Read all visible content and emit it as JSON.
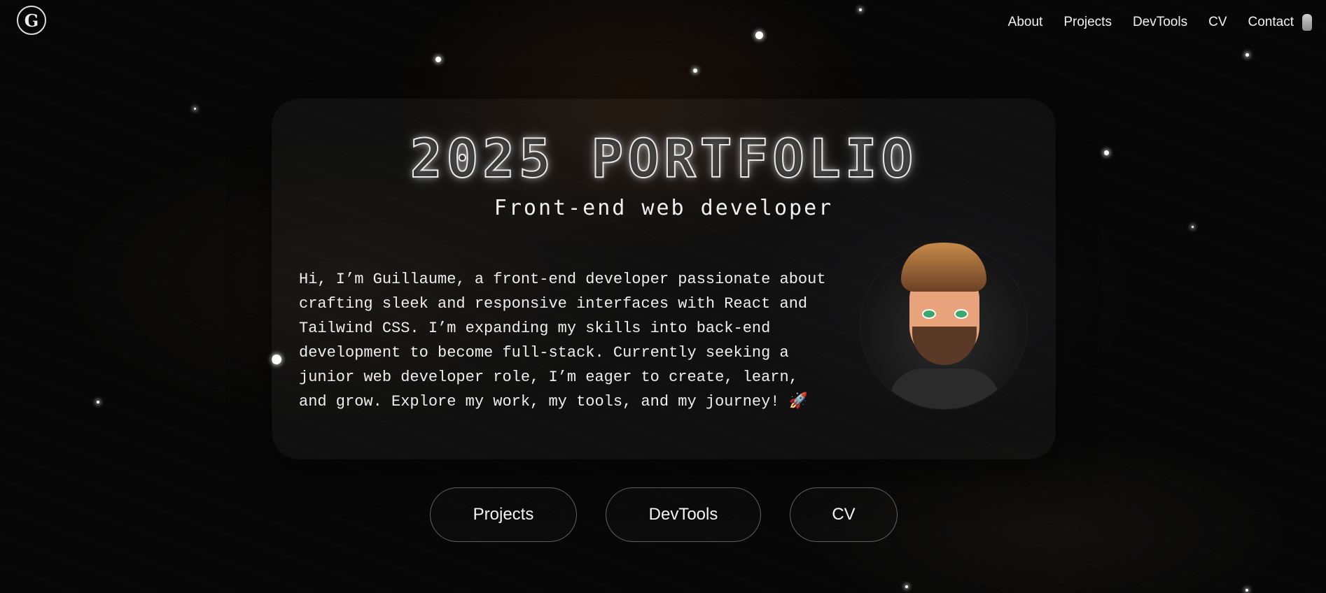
{
  "nav": {
    "logo": "G",
    "items": [
      "About",
      "Projects",
      "DevTools",
      "CV",
      "Contact"
    ]
  },
  "hero": {
    "title": "2025 PORTFOLIO",
    "subtitle": "Front-end web developer",
    "intro": "Hi, I’m Guillaume, a front-end developer passionate about crafting sleek and responsive interfaces with React and Tailwind CSS. I’m expanding my skills into back-end development to become full-stack. Currently seeking a junior web developer role, I’m eager to create, learn, and grow. Explore my work, my tools, and my journey! 🚀"
  },
  "buttons": [
    "Projects",
    "DevTools",
    "CV"
  ],
  "colors": {
    "background": "#070707",
    "text": "#ffffff"
  }
}
